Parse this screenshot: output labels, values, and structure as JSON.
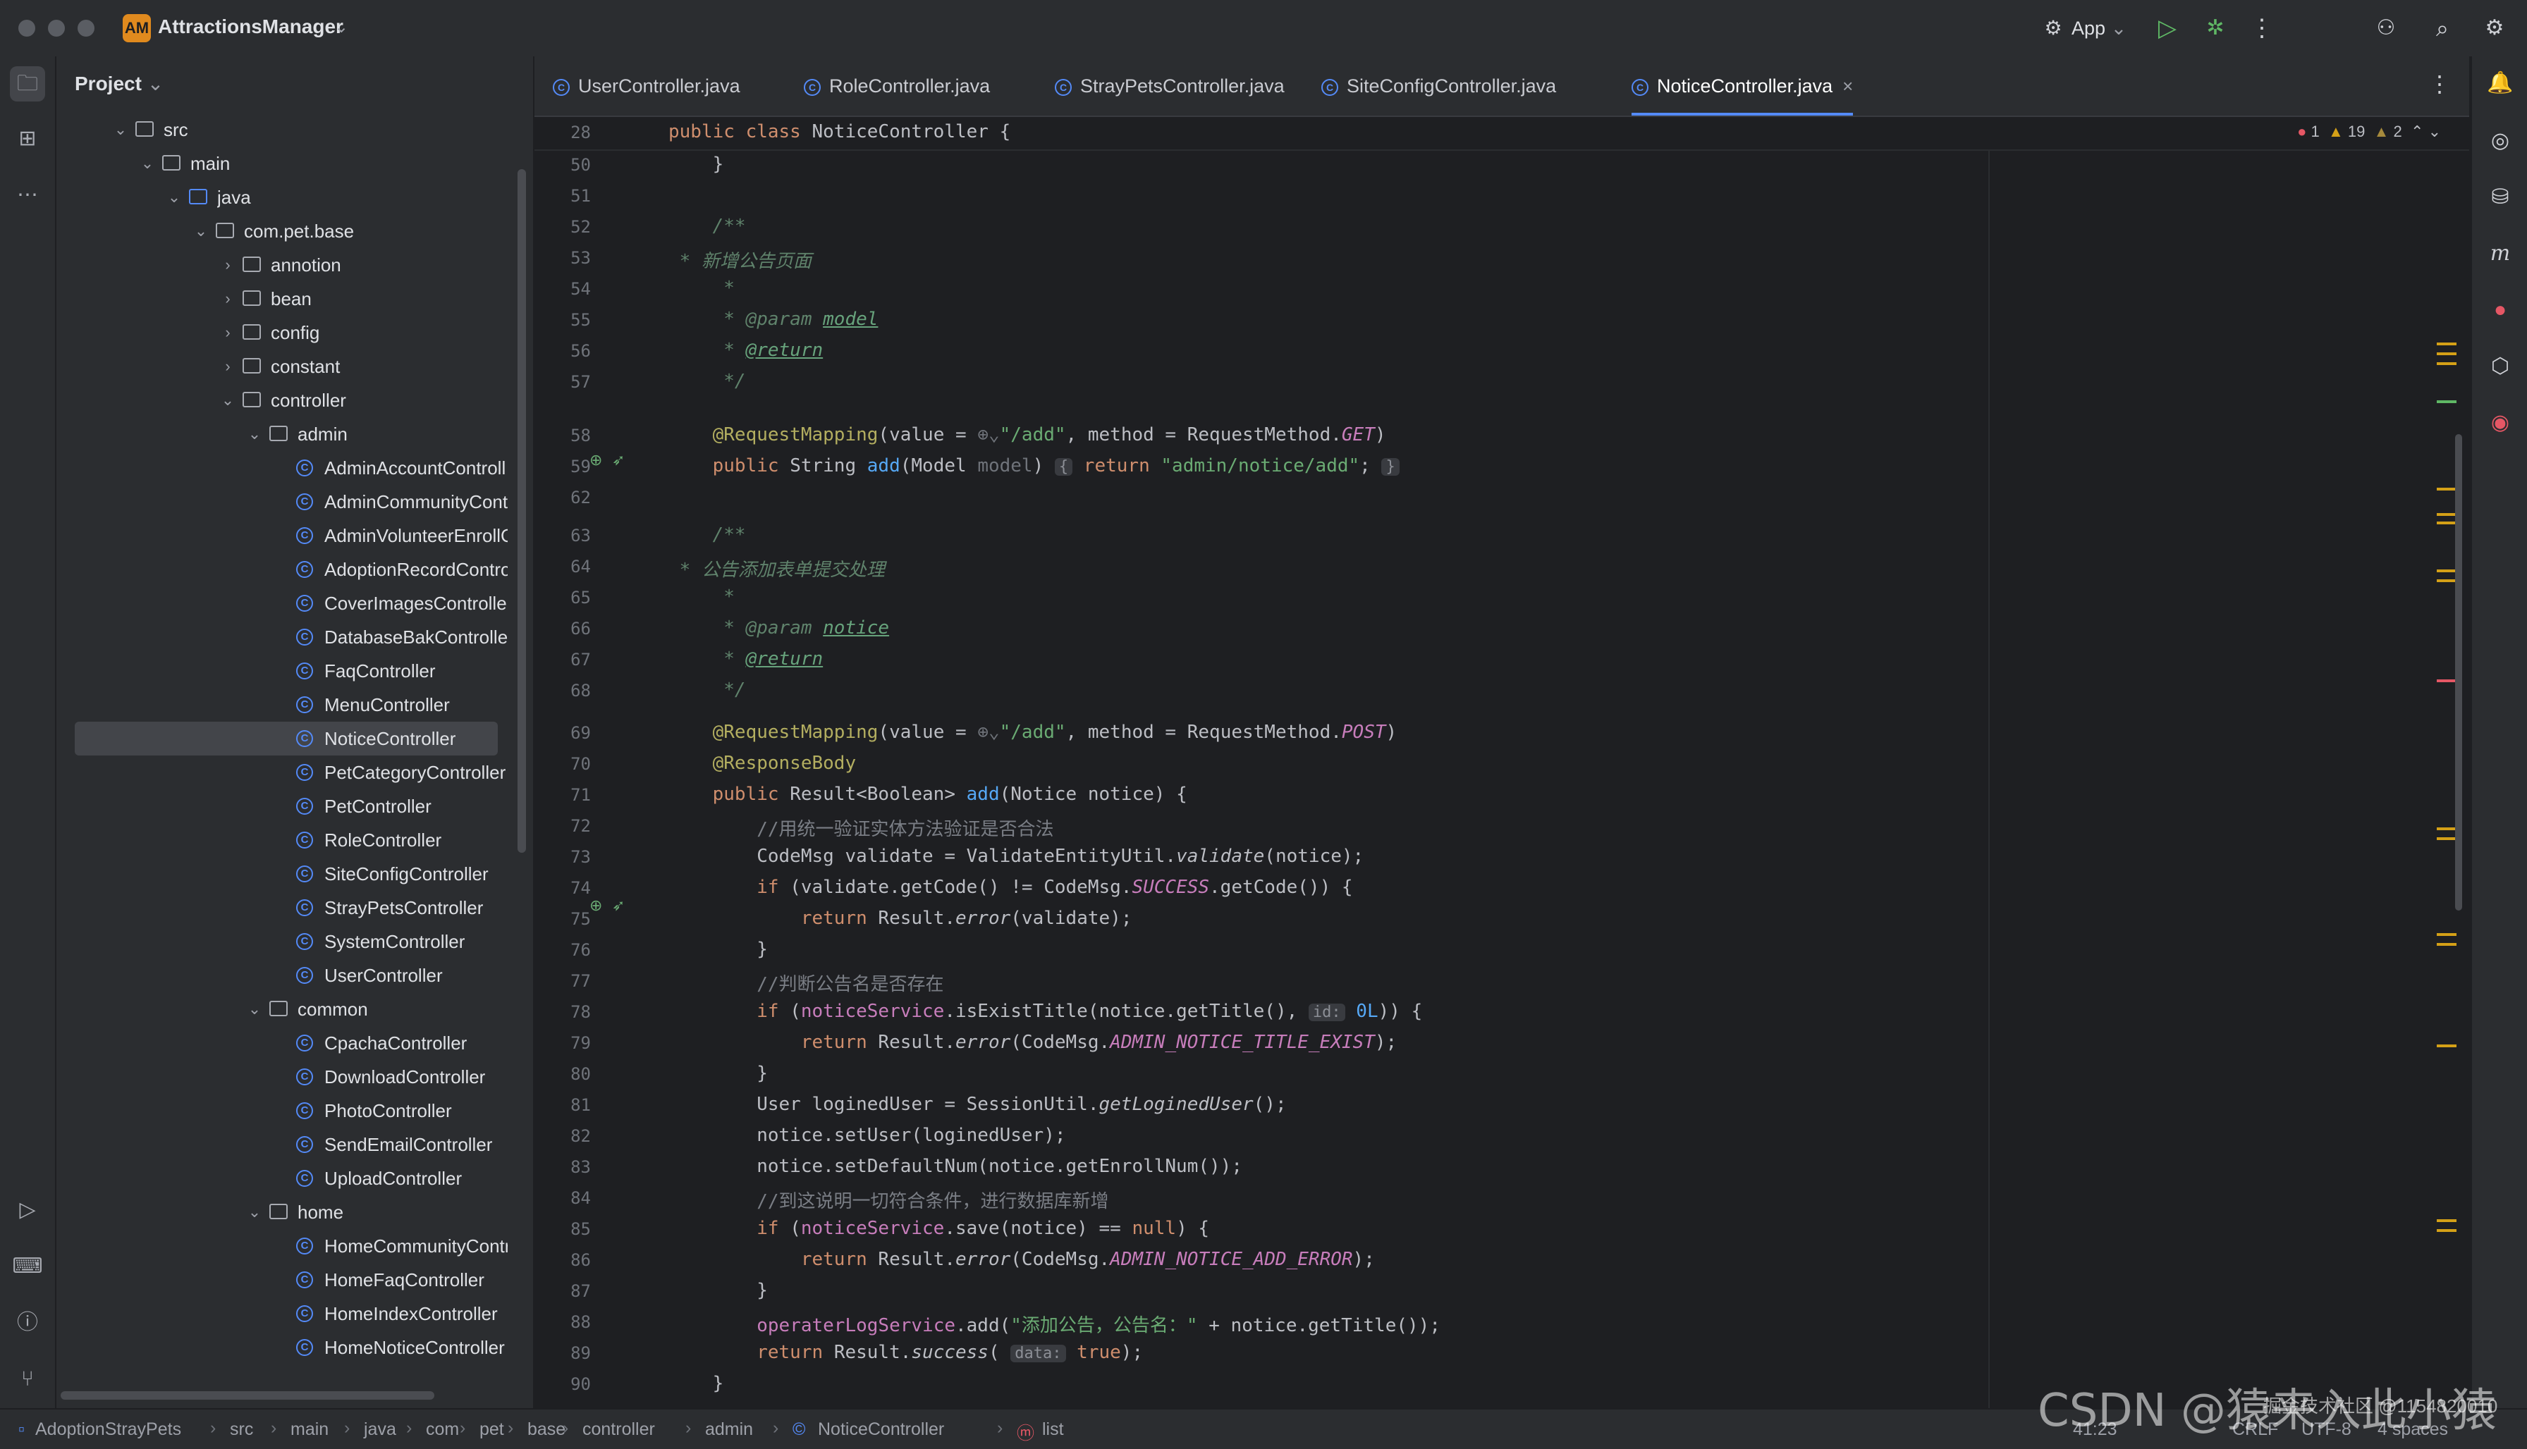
{
  "titlebar": {
    "project_badge": "AM",
    "project_name": "AttractionsManager",
    "run_config": "App"
  },
  "project_panel": {
    "header": "Project",
    "tree": [
      {
        "label": "src",
        "depth": 1,
        "type": "folder",
        "expanded": true
      },
      {
        "label": "main",
        "depth": 2,
        "type": "folder",
        "expanded": true
      },
      {
        "label": "java",
        "depth": 3,
        "type": "folder-blue",
        "expanded": true
      },
      {
        "label": "com.pet.base",
        "depth": 4,
        "type": "package",
        "expanded": true
      },
      {
        "label": "annotion",
        "depth": 5,
        "type": "package",
        "expanded": false
      },
      {
        "label": "bean",
        "depth": 5,
        "type": "package",
        "expanded": false
      },
      {
        "label": "config",
        "depth": 5,
        "type": "package",
        "expanded": false
      },
      {
        "label": "constant",
        "depth": 5,
        "type": "package",
        "expanded": false
      },
      {
        "label": "controller",
        "depth": 5,
        "type": "package",
        "expanded": true
      },
      {
        "label": "admin",
        "depth": 6,
        "type": "package",
        "expanded": true
      },
      {
        "label": "AdminAccountControll",
        "depth": 7,
        "type": "class"
      },
      {
        "label": "AdminCommunityConti",
        "depth": 7,
        "type": "class"
      },
      {
        "label": "AdminVolunteerEnrollC",
        "depth": 7,
        "type": "class"
      },
      {
        "label": "AdoptionRecordContro",
        "depth": 7,
        "type": "class"
      },
      {
        "label": "CoverImagesController",
        "depth": 7,
        "type": "class"
      },
      {
        "label": "DatabaseBakController",
        "depth": 7,
        "type": "class"
      },
      {
        "label": "FaqController",
        "depth": 7,
        "type": "class"
      },
      {
        "label": "MenuController",
        "depth": 7,
        "type": "class"
      },
      {
        "label": "NoticeController",
        "depth": 7,
        "type": "class",
        "selected": true
      },
      {
        "label": "PetCategoryController",
        "depth": 7,
        "type": "class"
      },
      {
        "label": "PetController",
        "depth": 7,
        "type": "class"
      },
      {
        "label": "RoleController",
        "depth": 7,
        "type": "class"
      },
      {
        "label": "SiteConfigController",
        "depth": 7,
        "type": "class"
      },
      {
        "label": "StrayPetsController",
        "depth": 7,
        "type": "class"
      },
      {
        "label": "SystemController",
        "depth": 7,
        "type": "class"
      },
      {
        "label": "UserController",
        "depth": 7,
        "type": "class"
      },
      {
        "label": "common",
        "depth": 6,
        "type": "package",
        "expanded": true
      },
      {
        "label": "CpachaController",
        "depth": 7,
        "type": "class"
      },
      {
        "label": "DownloadController",
        "depth": 7,
        "type": "class"
      },
      {
        "label": "PhotoController",
        "depth": 7,
        "type": "class"
      },
      {
        "label": "SendEmailController",
        "depth": 7,
        "type": "class"
      },
      {
        "label": "UploadController",
        "depth": 7,
        "type": "class"
      },
      {
        "label": "home",
        "depth": 6,
        "type": "package",
        "expanded": true
      },
      {
        "label": "HomeCommunityContr",
        "depth": 7,
        "type": "class"
      },
      {
        "label": "HomeFaqController",
        "depth": 7,
        "type": "class"
      },
      {
        "label": "HomeIndexController",
        "depth": 7,
        "type": "class"
      },
      {
        "label": "HomeNoticeController",
        "depth": 7,
        "type": "class"
      }
    ]
  },
  "tabs": [
    {
      "label": "UserController.java",
      "active": false
    },
    {
      "label": "RoleController.java",
      "active": false
    },
    {
      "label": "StrayPetsController.java",
      "active": false
    },
    {
      "label": "SiteConfigController.java",
      "active": false
    },
    {
      "label": "NoticeController.java",
      "active": true
    }
  ],
  "editor": {
    "sticky_line_number": "28",
    "sticky_code": "public class NoticeController {",
    "inspections": {
      "errors": "1",
      "warnings": "19",
      "weak_warnings": "2"
    },
    "line_numbers": [
      "50",
      "51",
      "52",
      "53",
      "54",
      "55",
      "56",
      "57",
      "",
      "58",
      "59",
      "62",
      "63",
      "64",
      "65",
      "66",
      "67",
      "68",
      "",
      "69",
      "70",
      "71",
      "72",
      "73",
      "74",
      "75",
      "76",
      "77",
      "78",
      "79",
      "80",
      "81",
      "82",
      "83",
      "84",
      "85",
      "86",
      "87",
      "88",
      "89",
      "90"
    ],
    "comments": {
      "add_page": " * 新增公告页面",
      "add_submit": " * 公告添加表单提交处理",
      "validate": "//用统一验证实体方法验证是否合法",
      "exists": "//判断公告名是否存在",
      "ok": "//到这说明一切符合条件，进行数据库新增",
      "log_msg": "\"添加公告，公告名：\""
    }
  },
  "statusbar": {
    "breadcrumbs": [
      "AdoptionStrayPets",
      "src",
      "main",
      "java",
      "com",
      "pet",
      "base",
      "controller",
      "admin",
      "NoticeController",
      "list"
    ],
    "position": "41:23",
    "line_sep": "CRLF",
    "encoding": "UTF-8",
    "indent": "4 spaces"
  },
  "watermark": {
    "text": "CSDN @猿来入此小猿",
    "sub": "掘金技术社区 @1154820010"
  },
  "colors": {
    "accent": "#548af7",
    "background": "#1e1f22",
    "panel": "#2b2d30",
    "keyword": "#cf8e6d",
    "string": "#6aab73",
    "annotation": "#b3ae60"
  }
}
